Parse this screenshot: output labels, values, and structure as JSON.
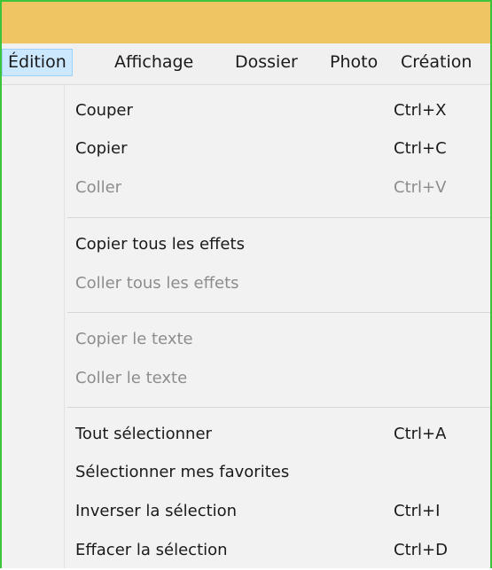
{
  "menubar": {
    "items": [
      {
        "label": "Édition",
        "active": true
      },
      {
        "label": "Affichage",
        "active": false
      },
      {
        "label": "Dossier",
        "active": false
      },
      {
        "label": "Photo",
        "active": false
      },
      {
        "label": "Création",
        "active": false
      }
    ]
  },
  "menu": {
    "items": [
      {
        "label": "Couper",
        "shortcut": "Ctrl+X",
        "enabled": true
      },
      {
        "label": "Copier",
        "shortcut": "Ctrl+C",
        "enabled": true
      },
      {
        "label": "Coller",
        "shortcut": "Ctrl+V",
        "enabled": false
      },
      {
        "label": "Copier tous les effets",
        "shortcut": "",
        "enabled": true
      },
      {
        "label": "Coller tous les effets",
        "shortcut": "",
        "enabled": false
      },
      {
        "label": "Copier le texte",
        "shortcut": "",
        "enabled": false
      },
      {
        "label": "Coller le texte",
        "shortcut": "",
        "enabled": false
      },
      {
        "label": "Tout sélectionner",
        "shortcut": "Ctrl+A",
        "enabled": true
      },
      {
        "label": "Sélectionner mes favorites",
        "shortcut": "",
        "enabled": true
      },
      {
        "label": "Inverser la sélection",
        "shortcut": "Ctrl+I",
        "enabled": true
      },
      {
        "label": "Effacer la sélection",
        "shortcut": "Ctrl+D",
        "enabled": true
      }
    ]
  },
  "colors": {
    "titlebar": "#efc563",
    "frame_border": "#3cc43c",
    "menu_active_bg": "#cce8ff",
    "menu_active_border": "#99d1ff",
    "disabled_text": "#8d8d8d"
  }
}
